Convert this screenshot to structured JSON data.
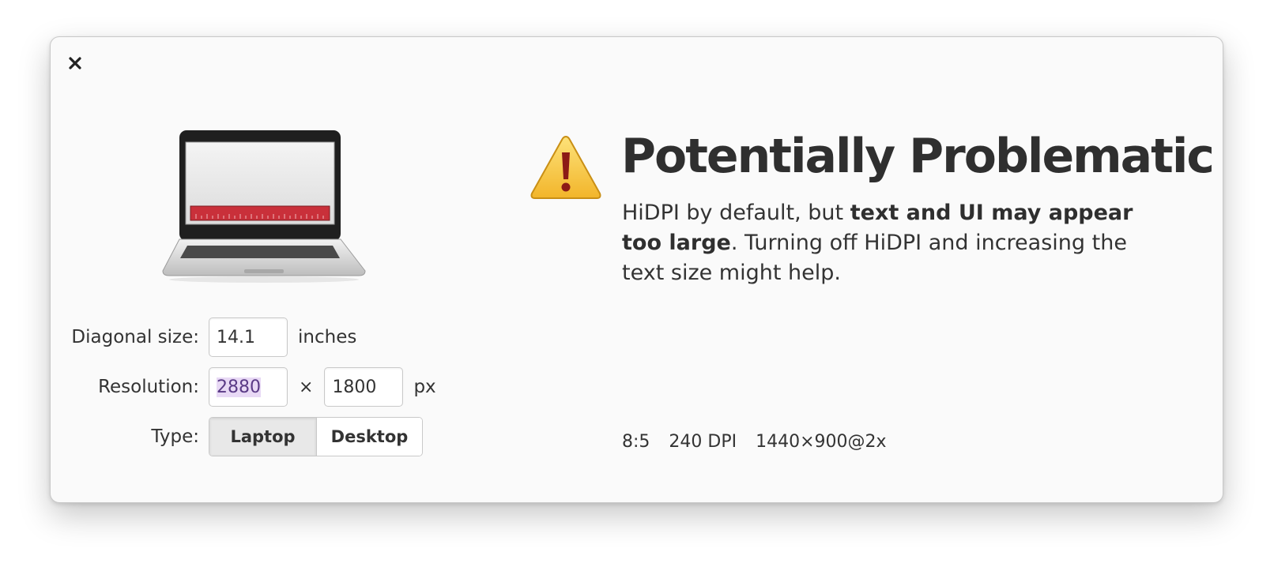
{
  "dialog": {
    "close_label": "×"
  },
  "form": {
    "diagonal_label": "Diagonal size:",
    "diagonal_value": "14.1",
    "diagonal_unit": "inches",
    "resolution_label": "Resolution:",
    "resolution_width": "2880",
    "resolution_separator": "×",
    "resolution_height": "1800",
    "resolution_unit": "px",
    "type_label": "Type:",
    "type_options": [
      "Laptop",
      "Desktop"
    ],
    "type_selected": "Laptop"
  },
  "result": {
    "title": "Potentially Problematic",
    "desc_prefix": "HiDPI by default, but ",
    "desc_bold": "text and UI may appear too large",
    "desc_suffix": ". Turning off HiDPI and increasing the text size might help.",
    "aspect_ratio": "8:5",
    "dpi": "240 DPI",
    "scaled_resolution": "1440×900@2x"
  },
  "icons": {
    "device": "laptop-icon",
    "status": "warning-icon",
    "close": "close-icon"
  },
  "colors": {
    "warning_yellow": "#f5c73a",
    "warning_mark": "#8c1b16",
    "ruler_red": "#c9303a",
    "selection_bg": "#e8d9f5"
  }
}
